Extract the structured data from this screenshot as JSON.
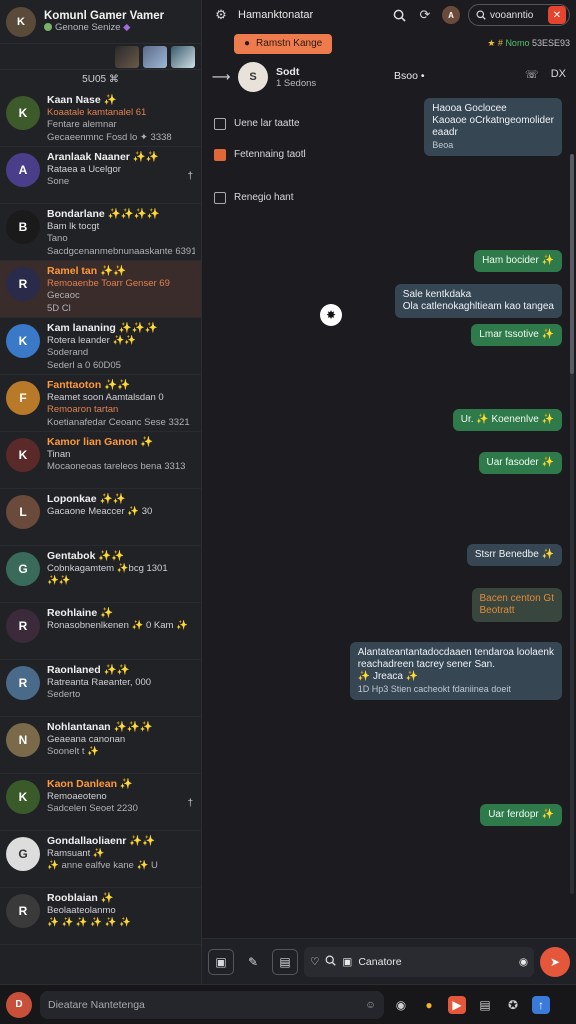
{
  "colors": {
    "accent": "#e5573a",
    "outgoing": "#2f7a4a",
    "incoming": "#364653",
    "active_row": "#3a2c2a"
  },
  "profile": {
    "name": "Komunl Gamer Vamer",
    "status": "Genone Senize",
    "avatar_initial": "K"
  },
  "sidebar": {
    "section_header": "5U05 ⌘",
    "chats": [
      {
        "initial": "K",
        "color": "#3d5a2a",
        "name": "Kaan Nase ✨",
        "line1": "Koaatale kamtanalel 61",
        "line2": "Fentare alemnar",
        "line3": "Gecaeenmnc Fosd lo ✦ 3338",
        "line1_red": true,
        "mark": ""
      },
      {
        "initial": "A",
        "color": "#4a3d8a",
        "name": "Aranlaak Naaner ✨✨",
        "line1": "Rataea a Ucelgor",
        "line2": "Sone",
        "line3": "",
        "mark": "†"
      },
      {
        "initial": "B",
        "color": "#1a1a1a",
        "name": "Bondarlane ✨✨✨✨",
        "line1": "Bam lk tocgt",
        "line2": "Tano",
        "line3": "Sacdgcenanmebnunaaskante 6391",
        "mark": ""
      },
      {
        "initial": "R",
        "color": "#2a2a4a",
        "name": "Ramel tan ✨✨",
        "line1": "Remoaenbe Toarr Genser 69",
        "line2": "Gecaoc",
        "line3": "5D Cl",
        "orange": true,
        "line1_red": true,
        "active": true,
        "mark": ""
      },
      {
        "initial": "K",
        "color": "#3a78c8",
        "name": "Kam lananing ✨✨✨",
        "line1": "Rotera leander ✨✨",
        "line2": "Soderand",
        "line3": "Sederl a 0 60D05",
        "mark": ""
      },
      {
        "initial": "F",
        "color": "#b87a28",
        "name": "Fanttaoton ✨✨",
        "line1": "Reamet soon Aamtalsdan 0",
        "line2": "Remoaron tartan",
        "line3": "Koetianafedar Ceoanc Sese 3321",
        "orange": true,
        "line2_red": true,
        "mark": ""
      },
      {
        "initial": "K",
        "color": "#5a2a2a",
        "name": "Kamor lian Ganon ✨",
        "line1": "Tinan",
        "line2": "Mocaoneoas tareleos bena 3313",
        "line3": "",
        "orange": true,
        "mark": ""
      },
      {
        "initial": "L",
        "color": "#6a4a3a",
        "name": "Loponkae ✨✨",
        "line1": "Gacaone Meaccer ✨ 30",
        "line2": "",
        "line3": "",
        "mark": ""
      },
      {
        "initial": "G",
        "color": "#3a6a5a",
        "name": "Gentabok ✨✨",
        "line1": "Cobnkagamtem ✨bcg 1301",
        "line2": "✨✨",
        "line3": "",
        "mark": ""
      },
      {
        "initial": "R",
        "color": "#3a2a3a",
        "name": "Reohlaine ✨",
        "line1": "Ronasobnenlkenen ✨ 0 Kam ✨",
        "line2": "",
        "line3": "",
        "mark": ""
      },
      {
        "initial": "R",
        "color": "#4a6a8a",
        "name": "Raonlaned ✨✨",
        "line1": "Ratreanta Raeanter, 000",
        "line2": "Sederto",
        "line3": "",
        "mark": ""
      },
      {
        "initial": "N",
        "color": "#7a6a4a",
        "name": "Nohlantanan ✨✨✨",
        "line1": "Geaeana canonan",
        "line2": "Soonelt t ✨",
        "line3": "",
        "mark": ""
      },
      {
        "initial": "K",
        "color": "#3a5a2a",
        "name": "Kaon Danlean ✨",
        "line1": "Remoaeoteno",
        "line2": "",
        "line3": "Sadcelen Seoet 2230",
        "orange": true,
        "mark": "†"
      },
      {
        "initial": "G",
        "color": "#dddddd",
        "name": "Gondallaoliaenr ✨✨",
        "line1": "Ramsuant ✨",
        "line2": "✨ anne ealfve kane ✨ U",
        "line3": "",
        "mark": ""
      },
      {
        "initial": "R",
        "color": "#3a3a3a",
        "name": "Rooblaian ✨",
        "line1": "Beolaateolanmo",
        "line2": "✨ ✨ ✨ ✨ ✨ ✨",
        "line3": "",
        "mark": ""
      }
    ]
  },
  "topbar": {
    "title": "Hamanktonatar",
    "search_placeholder": "vooanntio"
  },
  "content": {
    "banner": "Ramstn Kange",
    "tags_left": "★ #",
    "tags_green": "Nomo",
    "tags_right": "53ESE93",
    "chat_head": {
      "name": "Sodt",
      "sub": "1 Sedons",
      "center": "Bsoo •",
      "call_icon": "phone-icon",
      "close": "DX"
    },
    "options": [
      {
        "label": "Uene lar taatte",
        "red": false
      },
      {
        "label": "Fetennaing taotl",
        "red": true
      },
      {
        "label": "Renegio hant",
        "red": false
      }
    ],
    "messages": [
      {
        "type": "in",
        "lines": [
          "Haooa Goclocee",
          "Kaoaoe oCrkatngeomolider",
          "eaadr",
          "Beoa"
        ]
      },
      {
        "type": "out",
        "lines": [
          "Ham bocider ✨"
        ]
      },
      {
        "type": "in",
        "lines": [
          "Sale kentkdaka",
          "Ola catlenokaghltieam kao tangea"
        ]
      },
      {
        "type": "out",
        "lines": [
          "Lmar tssotive ✨"
        ]
      },
      {
        "type": "out",
        "lines": [
          "Ur. ✨ Koenenlve ✨"
        ]
      },
      {
        "type": "out",
        "lines": [
          "Uar fasoder ✨"
        ]
      },
      {
        "type": "in",
        "lines": [
          "Stsrr Benedbe ✨"
        ]
      },
      {
        "type": "warn",
        "lines": [
          "Bacen centon Gt",
          "Beotratt"
        ]
      },
      {
        "type": "in",
        "lines": [
          "Alantateantantadocdaaen tendaroa loolaenk",
          "reachadreen tacrey sener San.",
          "✨ Jreaca ✨",
          "1D Hp3 Stien cacheokt fdaniinea doeit"
        ]
      },
      {
        "type": "out",
        "lines": [
          "Uar ferdopr ✨"
        ]
      }
    ]
  },
  "composer": {
    "input_text": "Canatore"
  },
  "bottombar": {
    "placeholder": "Dieatare Nantetenga"
  }
}
